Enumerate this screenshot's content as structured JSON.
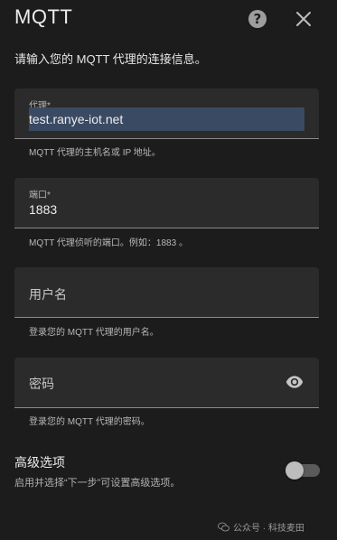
{
  "dialog": {
    "title": "MQTT",
    "intro": "请输入您的 MQTT 代理的连接信息。"
  },
  "fields": {
    "broker": {
      "label": "代理*",
      "value": "test.ranye-iot.net",
      "helper": "MQTT 代理的主机名或 IP 地址。"
    },
    "port": {
      "label": "端口*",
      "value": "1883",
      "helper": "MQTT 代理侦听的端口。例如：1883 。"
    },
    "username": {
      "placeholder": "用户名",
      "helper": "登录您的 MQTT 代理的用户名。"
    },
    "password": {
      "placeholder": "密码",
      "helper": "登录您的 MQTT 代理的密码。"
    }
  },
  "advanced": {
    "title": "高级选项",
    "description": "启用并选择“下一步”可设置高级选项。",
    "enabled": false
  },
  "watermark": {
    "text": "公众号 · 科技麦田"
  },
  "colors": {
    "background": "#1c1c1c",
    "field_background": "#2b2b2b",
    "selection_highlight": "#3a4a63"
  }
}
